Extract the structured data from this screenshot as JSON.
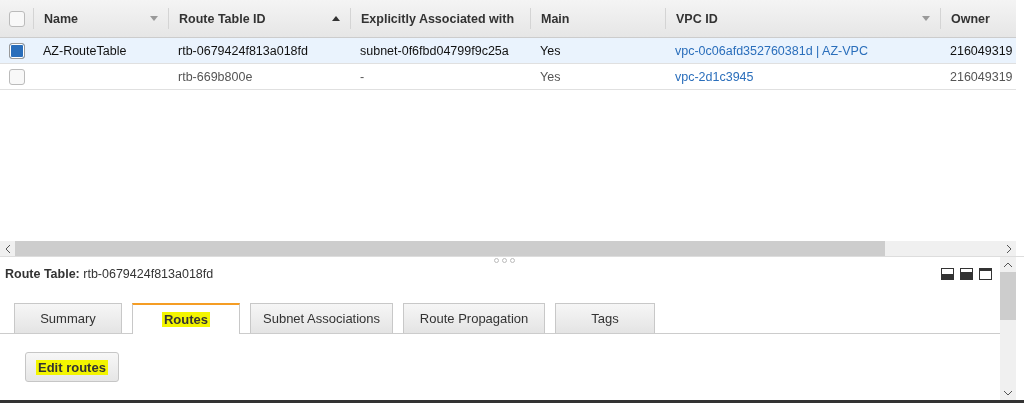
{
  "table": {
    "select_all_checked": false,
    "columns": [
      {
        "label": "Name",
        "kind": "menu"
      },
      {
        "label": "Route Table ID",
        "kind": "sorted"
      },
      {
        "label": "Explicitly Associated with",
        "kind": "plain"
      },
      {
        "label": "Main",
        "kind": "plain"
      },
      {
        "label": "VPC ID",
        "kind": "menu"
      },
      {
        "label": "Owner",
        "kind": "plain"
      }
    ],
    "rows": [
      {
        "selected": true,
        "checked": true,
        "cells": [
          "AZ-RouteTable",
          "rtb-0679424f813a018fd",
          "subnet-0f6fbd04799f9c25a",
          "Yes",
          "vpc-0c06afd352760381d | AZ-VPC",
          "216049319"
        ]
      },
      {
        "selected": false,
        "checked": false,
        "cells": [
          "",
          "rtb-669b800e",
          "-",
          "Yes",
          "vpc-2d1c3945",
          "216049319"
        ]
      }
    ]
  },
  "detail": {
    "label": "Route Table:",
    "value": "rtb-0679424f813a018fd",
    "tabs": [
      {
        "label": "Summary",
        "selected": false,
        "highlighted": false
      },
      {
        "label": "Routes",
        "selected": true,
        "highlighted": true
      },
      {
        "label": "Subnet Associations",
        "selected": false,
        "highlighted": false
      },
      {
        "label": "Route Propagation",
        "selected": false,
        "highlighted": false
      },
      {
        "label": "Tags",
        "selected": false,
        "highlighted": false
      }
    ],
    "button": {
      "label": "Edit routes",
      "highlighted": true
    }
  }
}
